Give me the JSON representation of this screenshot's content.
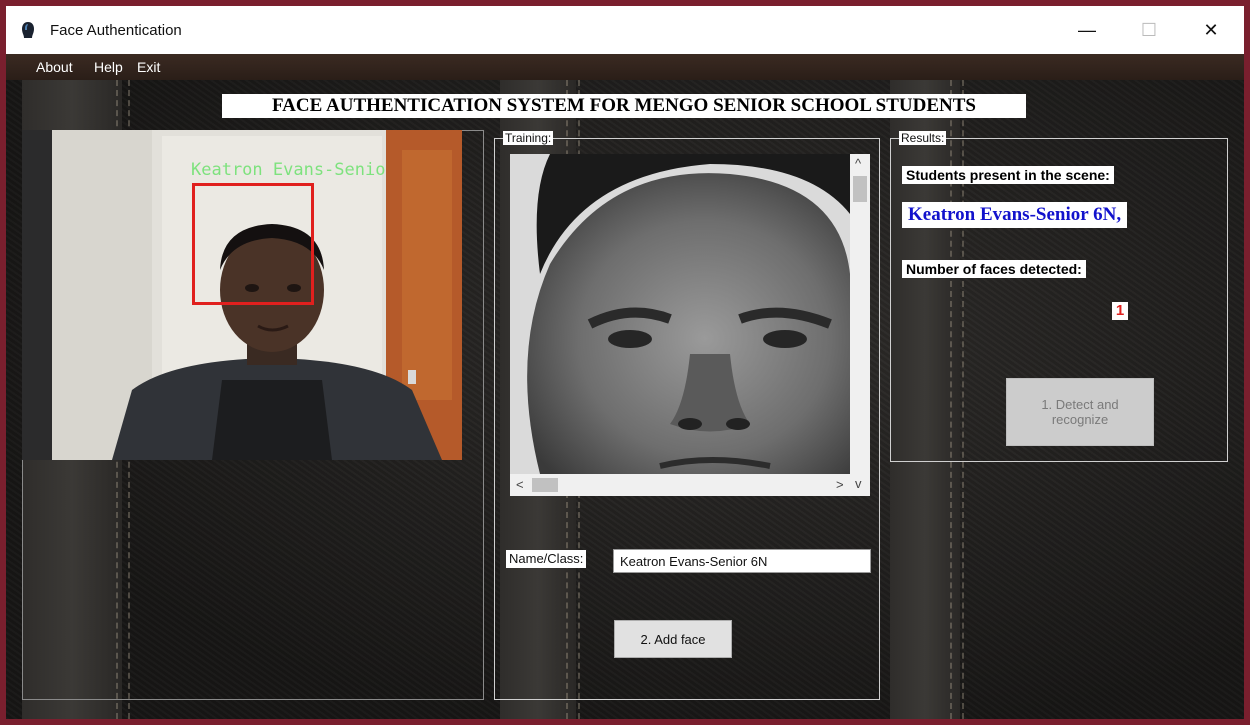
{
  "window": {
    "title": "Face Authentication",
    "minimize_glyph": "—",
    "maximize_glyph": "☐",
    "close_glyph": "✕"
  },
  "menu": {
    "items": [
      "About",
      "Help",
      "Exit"
    ]
  },
  "header": {
    "title": "FACE AUTHENTICATION SYSTEM FOR MENGO SENIOR SCHOOL STUDENTS"
  },
  "camera": {
    "overlay_name": "Keatron Evans-Senio",
    "face_box_color": "#e0201e",
    "overlay_text_color": "#7ee27e"
  },
  "training": {
    "legend": "Training:",
    "name_label": "Name/Class:",
    "name_value": "Keatron Evans-Senior 6N",
    "add_face_button": "2. Add face",
    "scroll_up": "^",
    "scroll_down": "v",
    "scroll_left": "<",
    "scroll_right": ">"
  },
  "results": {
    "legend": "Results:",
    "students_label": "Students present in the scene:",
    "students_value": "Keatron Evans-Senior 6N,",
    "faces_label": "Number of faces detected:",
    "faces_count": "1",
    "detect_button": "1. Detect and recognize"
  },
  "colors": {
    "window_border": "#7a1f2e",
    "recognized_text": "#1212cc",
    "count_text": "#e0201e"
  }
}
